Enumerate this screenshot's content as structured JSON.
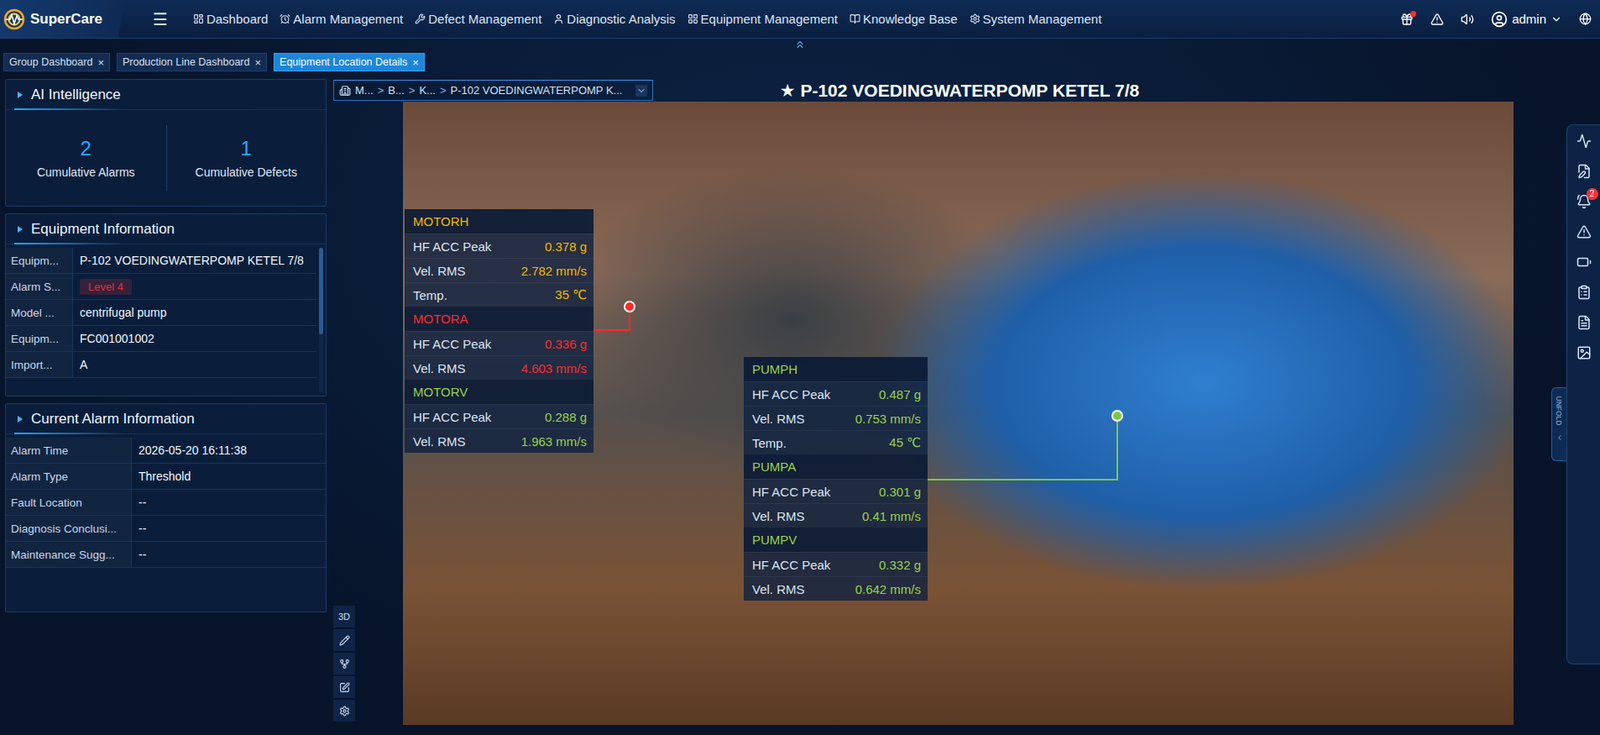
{
  "app": {
    "logo": "SuperCare",
    "menu_toggle": "☰"
  },
  "nav": [
    {
      "label": "Dashboard",
      "selected": false
    },
    {
      "label": "Alarm Management",
      "selected": false
    },
    {
      "label": "Defect Management",
      "selected": false
    },
    {
      "label": "Diagnostic Analysis",
      "selected": false
    },
    {
      "label": "Equipment Management",
      "selected": false
    },
    {
      "label": "Knowledge Base",
      "selected": false
    },
    {
      "label": "System Management",
      "selected": false
    }
  ],
  "header_icons": [
    {
      "kind": "gift",
      "dot": true
    },
    {
      "kind": "alert",
      "dot": false
    },
    {
      "kind": "sound",
      "dot": false
    }
  ],
  "user": {
    "name": "admin"
  },
  "tabs": [
    {
      "label": "Group Dashboard",
      "close": "×",
      "selected": false
    },
    {
      "label": "Production Line Dashboard",
      "close": "×",
      "selected": false
    },
    {
      "label": "Equipment Location Details",
      "close": "×",
      "selected": true
    }
  ],
  "ai_intelligence": {
    "title": "AI Intelligence",
    "stats": [
      {
        "value": "2",
        "label": "Cumulative Alarms"
      },
      {
        "value": "1",
        "label": "Cumulative Defects"
      }
    ]
  },
  "equipment_info": {
    "title": "Equipment Information",
    "rows": [
      {
        "label": "Equipm...",
        "value": "P-102 VOEDINGWATERPOMP KETEL 7/8",
        "kind": "text"
      },
      {
        "label": "Alarm S...",
        "value": "Level 4",
        "kind": "badge",
        "color": "#e0303a"
      },
      {
        "label": "Model ...",
        "value": "centrifugal pump",
        "kind": "text"
      },
      {
        "label": "Equipm...",
        "value": "FC001001002",
        "kind": "text"
      },
      {
        "label": "Import...",
        "value": "A",
        "kind": "text"
      }
    ]
  },
  "alarm_info": {
    "title": "Current Alarm Information",
    "rows": [
      {
        "label": "Alarm Time",
        "value": "2026-05-20 16:11:38"
      },
      {
        "label": "Alarm Type",
        "value": "Threshold"
      },
      {
        "label": "Fault Location",
        "value": "--"
      },
      {
        "label": "Diagnosis Conclusi...",
        "value": "--"
      },
      {
        "label": "Maintenance Sugg...",
        "value": "--"
      }
    ]
  },
  "breadcrumb": {
    "separator": ">",
    "items": [
      "M...",
      "B...",
      "K...",
      "P-102 VOEDINGWATERPOMP K..."
    ]
  },
  "title": {
    "star": "★",
    "text": "P-102 VOEDINGWATERPOMP KETEL 7/8"
  },
  "tools": [
    {
      "kind": "text",
      "label": "3D"
    },
    {
      "kind": "pen"
    },
    {
      "kind": "nodes"
    },
    {
      "kind": "edit"
    },
    {
      "kind": "gear"
    }
  ],
  "sensor_groups": [
    {
      "marker_color": "#ff2b2b",
      "channels": [
        {
          "name": "MOTORH",
          "color": "#f5b800",
          "readings": [
            {
              "label": "HF ACC Peak",
              "value": "0.378 g"
            },
            {
              "label": "Vel. RMS",
              "value": "2.782 mm/s"
            },
            {
              "label": "Temp.",
              "value": "35 ℃"
            }
          ]
        },
        {
          "name": "MOTORA",
          "color": "#ff2b2b",
          "readings": [
            {
              "label": "HF ACC Peak",
              "value": "0.336 g"
            },
            {
              "label": "Vel. RMS",
              "value": "4.603 mm/s"
            }
          ]
        },
        {
          "name": "MOTORV",
          "color": "#9ad14b",
          "readings": [
            {
              "label": "HF ACC Peak",
              "value": "0.288 g"
            },
            {
              "label": "Vel. RMS",
              "value": "1.963 mm/s"
            }
          ]
        }
      ]
    },
    {
      "marker_color": "#7ac943",
      "channels": [
        {
          "name": "PUMPH",
          "color": "#9ad14b",
          "readings": [
            {
              "label": "HF ACC Peak",
              "value": "0.487 g"
            },
            {
              "label": "Vel. RMS",
              "value": "0.753 mm/s"
            },
            {
              "label": "Temp.",
              "value": "45 ℃"
            }
          ]
        },
        {
          "name": "PUMPA",
          "color": "#9ad14b",
          "readings": [
            {
              "label": "HF ACC Peak",
              "value": "0.301 g"
            },
            {
              "label": "Vel. RMS",
              "value": "0.41 mm/s"
            }
          ]
        },
        {
          "name": "PUMPV",
          "color": "#9ad14b",
          "readings": [
            {
              "label": "HF ACC Peak",
              "value": "0.332 g"
            },
            {
              "label": "Vel. RMS",
              "value": "0.642 mm/s"
            }
          ]
        }
      ]
    }
  ],
  "side_rail": [
    {
      "kind": "wave"
    },
    {
      "kind": "report"
    },
    {
      "kind": "alarm",
      "badge": "2"
    },
    {
      "kind": "alert"
    },
    {
      "kind": "battery"
    },
    {
      "kind": "checklist"
    },
    {
      "kind": "document"
    },
    {
      "kind": "image"
    }
  ],
  "unfold": "UNFOLD"
}
